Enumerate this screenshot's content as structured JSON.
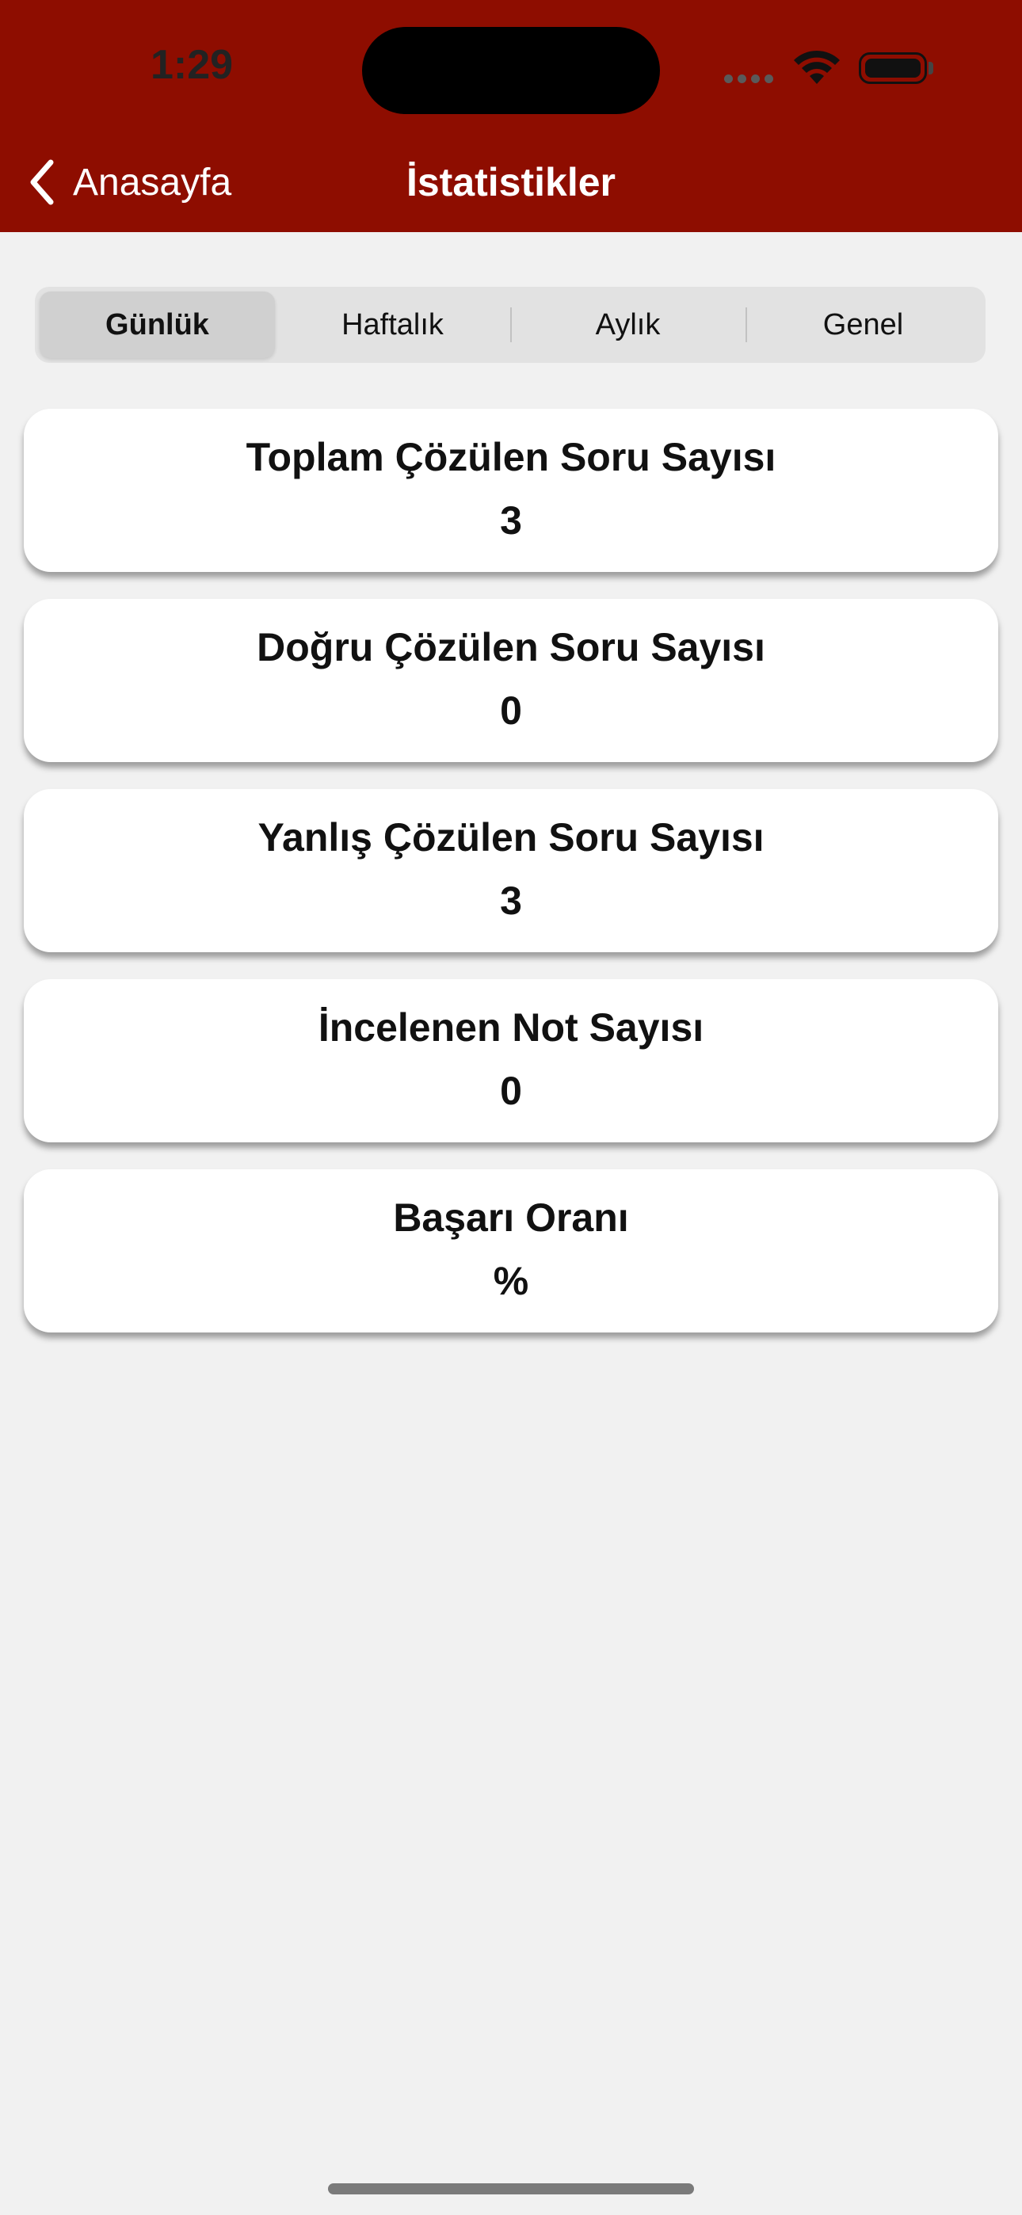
{
  "status_bar": {
    "time": "1:29"
  },
  "nav": {
    "back_label": "Anasayfa",
    "title": "İstatistikler"
  },
  "tabs": [
    {
      "label": "Günlük",
      "selected": true
    },
    {
      "label": "Haftalık",
      "selected": false
    },
    {
      "label": "Aylık",
      "selected": false
    },
    {
      "label": "Genel",
      "selected": false
    }
  ],
  "stats": [
    {
      "title": "Toplam Çözülen Soru Sayısı",
      "value": "3"
    },
    {
      "title": "Doğru Çözülen Soru Sayısı",
      "value": "0"
    },
    {
      "title": "Yanlış Çözülen Soru Sayısı",
      "value": "3"
    },
    {
      "title": "İncelenen Not Sayısı",
      "value": "0"
    },
    {
      "title": "Başarı Oranı",
      "value": "%"
    }
  ],
  "colors": {
    "header": "#8e0d00",
    "background": "#f1f1f1"
  },
  "icons": [
    "back-chevron-icon",
    "wifi-icon",
    "battery-icon",
    "signal-icon"
  ]
}
